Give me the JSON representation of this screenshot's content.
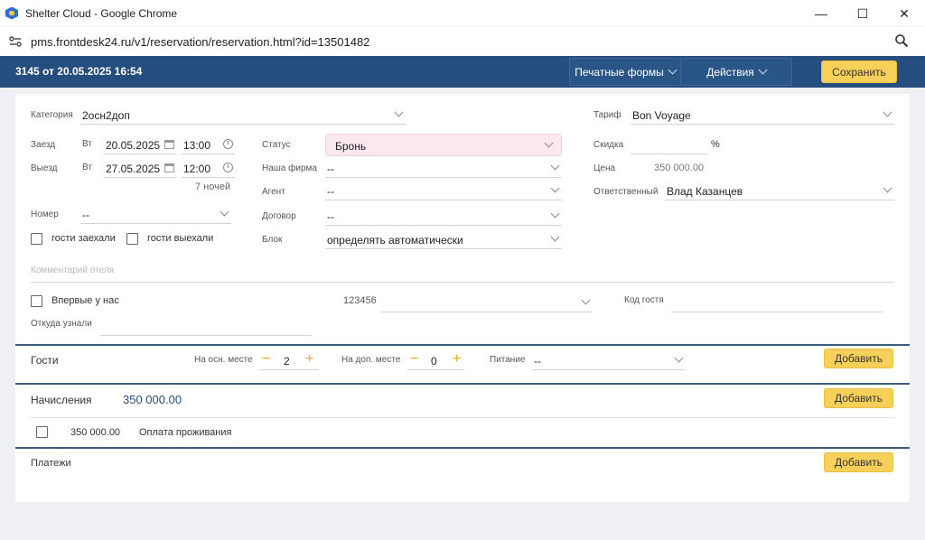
{
  "browser": {
    "window_title": "Shelter Cloud - Google Chrome",
    "url": "pms.frontdesk24.ru/v1/reservation/reservation.html?id=13501482",
    "controls": {
      "minimize": "—",
      "maximize": "☐",
      "close": "✕"
    }
  },
  "header": {
    "title": "3145 от 20.05.2025 16:54",
    "print_forms": "Печатные формы",
    "actions": "Действия",
    "save": "Сохранить"
  },
  "form": {
    "category": {
      "label": "Категория",
      "value": "2осн2доп"
    },
    "arrival": {
      "label": "Заезд",
      "weekday": "Вт",
      "date": "20.05.2025",
      "time": "13:00"
    },
    "departure": {
      "label": "Выезд",
      "weekday": "Вт",
      "date": "27.05.2025",
      "time": "12:00"
    },
    "nights": "7 ночей",
    "room": {
      "label": "Номер",
      "value": "--"
    },
    "guests_checked_in": "гости заехали",
    "guests_checked_out": "гости выехали",
    "status": {
      "label": "Статус",
      "value": "Бронь"
    },
    "our_company": {
      "label": "Наша фирма",
      "value": "--"
    },
    "agent": {
      "label": "Агент",
      "value": "--"
    },
    "contract": {
      "label": "Договор",
      "value": "--"
    },
    "block": {
      "label": "Блок",
      "value": "определять автоматически"
    },
    "tariff": {
      "label": "Тариф",
      "value": "Bon Voyage"
    },
    "discount": {
      "label": "Скидка",
      "value": "",
      "unit": "%"
    },
    "price": {
      "label": "Цена",
      "value": "350 000.00"
    },
    "responsible": {
      "label": "Ответственный",
      "value": "Влад Казанцев"
    },
    "hotel_comment_placeholder": "Комментарий отеля",
    "first_time": "Впервые у нас",
    "source_code": "123456",
    "guest_code": {
      "label": "Код гостя",
      "value": ""
    },
    "where_heard": {
      "label": "Откуда узнали",
      "value": ""
    }
  },
  "guests": {
    "title": "Гости",
    "main_places_label": "На осн. месте",
    "main_places": "2",
    "extra_places_label": "На доп. месте",
    "extra_places": "0",
    "meals_label": "Питание",
    "meals": "--",
    "add": "Добавить"
  },
  "charges": {
    "title": "Начисления",
    "total": "350 000.00",
    "add": "Добавить",
    "rows": [
      {
        "amount": "350 000.00",
        "description": "Оплата проживания"
      }
    ]
  },
  "payments": {
    "title": "Платежи",
    "add": "Добавить"
  }
}
